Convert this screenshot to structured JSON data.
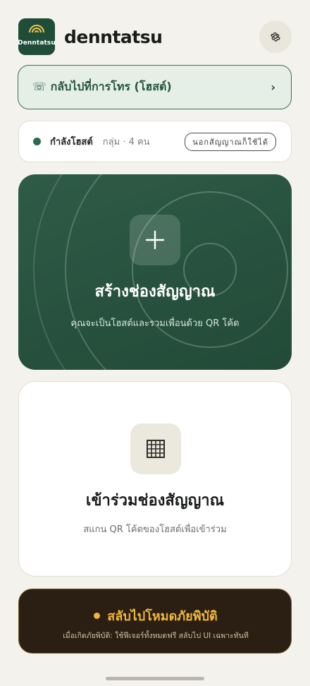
{
  "header": {
    "logo_text": "Denntatsu",
    "app_title": "denntatsu",
    "settings_icon": "gear-icon"
  },
  "return_call": {
    "icon": "phone-icon",
    "label": "☏ กลับไปที่การโทร (โฮสต์)",
    "chevron": "›"
  },
  "status": {
    "label": "กำลังโฮสต์",
    "meta": "กลุ่ม · 4 คน",
    "badge": "นอกสัญญาณก็ใช้ได้",
    "dot_color": "#2a6a4e"
  },
  "create_card": {
    "icon": "plus-icon",
    "title": "สร้างช่องสัญญาณ",
    "subtitle": "คุณจะเป็นโฮสต์และรวมเพื่อนด้วย QR โค้ด"
  },
  "join_card": {
    "icon": "qr-grid-icon",
    "title": "เข้าร่วมช่องสัญญาณ",
    "subtitle": "สแกน QR โค้ดของโฮสต์เพื่อเข้าร่วม"
  },
  "emergency": {
    "title": "สลับไปโหมดภัยพิบัติ",
    "subtitle": "เมื่อเกิดภัยพิบัติ: ใช้ฟีเจอร์ทั้งหมดฟรี สลับไป UI เฉพาะทันที",
    "accent": "#f0b63a"
  },
  "colors": {
    "brand_green": "#275340",
    "background": "#f4f2ec"
  }
}
